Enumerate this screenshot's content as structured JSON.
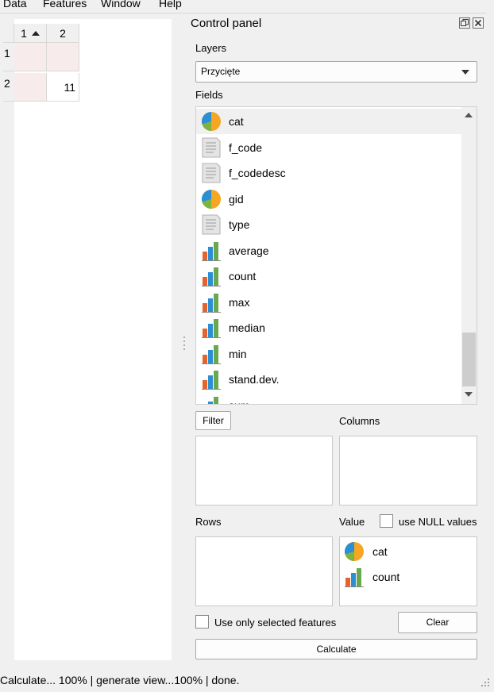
{
  "menubar": {
    "items": [
      "Data",
      "Features",
      "Window",
      "Help"
    ]
  },
  "table": {
    "columns": [
      "1",
      "2"
    ],
    "rows": [
      {
        "header": "1",
        "cells": [
          "",
          ""
        ]
      },
      {
        "header": "2",
        "cells": [
          "",
          "11"
        ]
      }
    ]
  },
  "panel": {
    "title": "Control panel",
    "layers_label": "Layers",
    "layer_selected": "Przycięte",
    "fields_label": "Fields",
    "fields": [
      {
        "label": "cat",
        "icon": "pie-chart-icon"
      },
      {
        "label": "f_code",
        "icon": "text-field-icon"
      },
      {
        "label": "f_codedesc",
        "icon": "text-field-icon"
      },
      {
        "label": "gid",
        "icon": "pie-chart-icon"
      },
      {
        "label": "type",
        "icon": "text-field-icon"
      },
      {
        "label": "average",
        "icon": "bar-chart-icon"
      },
      {
        "label": "count",
        "icon": "bar-chart-icon"
      },
      {
        "label": "max",
        "icon": "bar-chart-icon"
      },
      {
        "label": "median",
        "icon": "bar-chart-icon"
      },
      {
        "label": "min",
        "icon": "bar-chart-icon"
      },
      {
        "label": "stand.dev.",
        "icon": "bar-chart-icon"
      },
      {
        "label": "sum",
        "icon": "bar-chart-icon"
      }
    ],
    "filter_button": "Filter",
    "columns_label": "Columns",
    "rows_label": "Rows",
    "value_label": "Value",
    "use_null_label": "use NULL values",
    "value_items": [
      {
        "label": "cat",
        "icon": "pie-chart-icon"
      },
      {
        "label": "count",
        "icon": "bar-chart-icon"
      }
    ],
    "use_selected_label": "Use only selected features",
    "clear_button": "Clear",
    "calculate_button": "Calculate"
  },
  "status": {
    "text": "Calculate... 100% |  generate view...100% |  done."
  },
  "colors": {
    "pink_cell": "#f7ebeb",
    "pie_orange": "#f5a623",
    "pie_blue": "#2a8fd4",
    "pie_green": "#7cb342",
    "bar_orange": "#e8632b",
    "bar_blue": "#2a8fd4",
    "bar_green": "#6aa84f"
  }
}
